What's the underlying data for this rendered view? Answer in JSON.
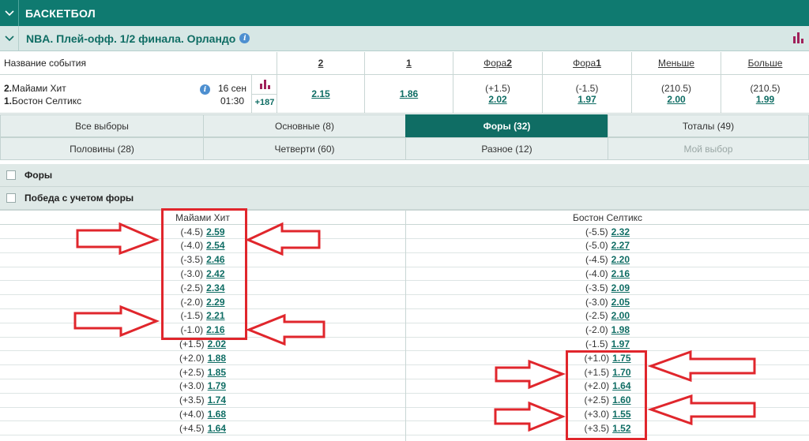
{
  "sport": {
    "title": "БАСКЕТБОЛ"
  },
  "league": {
    "title": "NBA. Плей-офф. 1/2 финала. Орландо"
  },
  "header": {
    "event_name_label": "Название события",
    "col_2": "2",
    "col_1": "1",
    "fora2_prefix": "Фора",
    "fora2_num": "2",
    "fora1_prefix": "Фора",
    "fora1_num": "1",
    "less": "Меньше",
    "more": "Больше"
  },
  "event": {
    "team1_num": "2.",
    "team1": "Майами Хит",
    "team2_num": "1.",
    "team2": "Бостон Селтикс",
    "date": "16 сен",
    "time": "01:30",
    "more_markets": "+187",
    "odd_2": "2.15",
    "odd_1": "1.86",
    "fora2_hc": "(+1.5)",
    "fora2_odd": "2.02",
    "fora1_hc": "(-1.5)",
    "fora1_odd": "1.97",
    "less_hc": "(210.5)",
    "less_odd": "2.00",
    "more_hc": "(210.5)",
    "more_odd": "1.99"
  },
  "tabs": [
    {
      "label": "Все выборы"
    },
    {
      "label": "Основные (8)"
    },
    {
      "label": "Форы (32)"
    },
    {
      "label": "Тоталы (49)"
    },
    {
      "label": "Половины (28)"
    },
    {
      "label": "Четверти (60)"
    },
    {
      "label": "Разное (12)"
    },
    {
      "label": "Мой выбор"
    }
  ],
  "sections": {
    "fory": "Форы",
    "pobeda": "Победа с учетом форы"
  },
  "grid": {
    "left_team": "Майами Хит",
    "right_team": "Бостон Селтикс",
    "rows": [
      {
        "lh": "(-4.5)",
        "lo": "2.59",
        "rh": "(-5.5)",
        "ro": "2.32"
      },
      {
        "lh": "(-4.0)",
        "lo": "2.54",
        "rh": "(-5.0)",
        "ro": "2.27"
      },
      {
        "lh": "(-3.5)",
        "lo": "2.46",
        "rh": "(-4.5)",
        "ro": "2.20"
      },
      {
        "lh": "(-3.0)",
        "lo": "2.42",
        "rh": "(-4.0)",
        "ro": "2.16"
      },
      {
        "lh": "(-2.5)",
        "lo": "2.34",
        "rh": "(-3.5)",
        "ro": "2.09"
      },
      {
        "lh": "(-2.0)",
        "lo": "2.29",
        "rh": "(-3.0)",
        "ro": "2.05"
      },
      {
        "lh": "(-1.5)",
        "lo": "2.21",
        "rh": "(-2.5)",
        "ro": "2.00"
      },
      {
        "lh": "(-1.0)",
        "lo": "2.16",
        "rh": "(-2.0)",
        "ro": "1.98"
      },
      {
        "lh": "(+1.5)",
        "lo": "2.02",
        "rh": "(-1.5)",
        "ro": "1.97"
      },
      {
        "lh": "(+2.0)",
        "lo": "1.88",
        "rh": "(+1.0)",
        "ro": "1.75"
      },
      {
        "lh": "(+2.5)",
        "lo": "1.85",
        "rh": "(+1.5)",
        "ro": "1.70"
      },
      {
        "lh": "(+3.0)",
        "lo": "1.79",
        "rh": "(+2.0)",
        "ro": "1.64"
      },
      {
        "lh": "(+3.5)",
        "lo": "1.74",
        "rh": "(+2.5)",
        "ro": "1.60"
      },
      {
        "lh": "(+4.0)",
        "lo": "1.68",
        "rh": "(+3.0)",
        "ro": "1.55"
      },
      {
        "lh": "(+4.5)",
        "lo": "1.64",
        "rh": "(+3.5)",
        "ro": "1.52"
      }
    ]
  },
  "colors": {
    "accent": "#0f7a70",
    "highlight": "#e0262c"
  },
  "icons": [
    "chevron-down-icon",
    "info-icon",
    "stats-icon",
    "checkbox-icon",
    "arrow-right-icon",
    "arrow-left-icon"
  ]
}
